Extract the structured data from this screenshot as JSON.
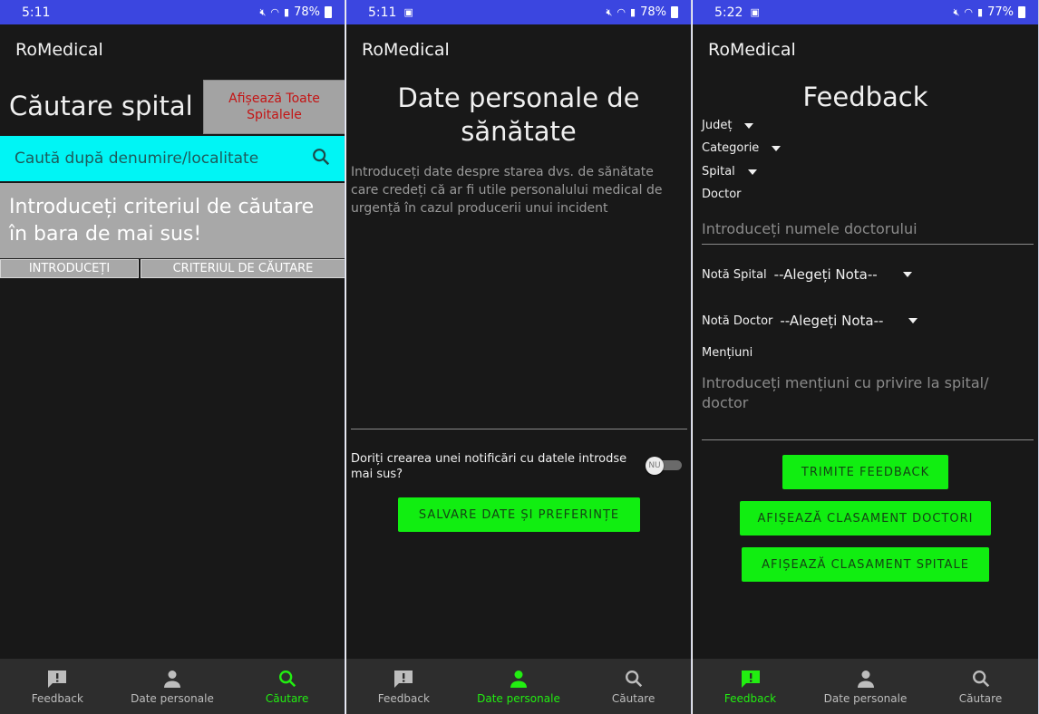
{
  "panels": [
    {
      "status": {
        "time": "5:11",
        "extra": "",
        "battery": "78%"
      },
      "app_title": "RoMedical",
      "title": "Căutare spital",
      "show_all_label": "Afișează Toate Spitalele",
      "search_placeholder": "Caută după denumire/localitate",
      "hint": "Introduceți criteriul de căutare în bara de mai sus!",
      "hint_cells": [
        "INTRODUCEȚI",
        "CRITERIUL DE CĂUTARE"
      ]
    },
    {
      "status": {
        "time": "5:11",
        "extra": "▣",
        "battery": "78%"
      },
      "app_title": "RoMedical",
      "title": "Date personale de sănătate",
      "description": "Introduceți date despre starea dvs. de sănătate care credeți că ar fi utile personalului medical de urgență în cazul producerii unui incident",
      "notification_question": "Doriți crearea unei notificări cu datele introdse mai sus?",
      "toggle_label": "NU",
      "save_button": "SALVARE DATE ȘI PREFERINȚE"
    },
    {
      "status": {
        "time": "5:22",
        "extra": "▣",
        "battery": "77%"
      },
      "app_title": "RoMedical",
      "title": "Feedback",
      "labels": {
        "judet": "Județ",
        "categorie": "Categorie",
        "spital": "Spital",
        "doctor": "Doctor",
        "mentiuni": "Mențiuni"
      },
      "doctor_placeholder": "Introduceți numele doctorului",
      "nota_spital": {
        "label": "Notă Spital",
        "value": "--Alegeți Nota--"
      },
      "nota_doctor": {
        "label": "Notă Doctor",
        "value": "--Alegeți Nota--"
      },
      "mentions_placeholder": "Introduceți mențiuni cu privire la spital/ doctor",
      "buttons": {
        "send": "TRIMITE FEEDBACK",
        "rank_doctors": "AFIȘEAZĂ CLASAMENT DOCTORI",
        "rank_hospitals": "AFIȘEAZĂ CLASAMENT SPITALE"
      }
    }
  ],
  "nav": {
    "feedback": "Feedback",
    "personal": "Date personale",
    "search": "Căutare"
  },
  "colors": {
    "status_bar": "#3b46e0",
    "accent_green": "#22ee11",
    "search_bar": "#00f5f5",
    "button_green": "#11ee11"
  },
  "icons": [
    "feedback-icon",
    "person-icon",
    "search-icon"
  ]
}
